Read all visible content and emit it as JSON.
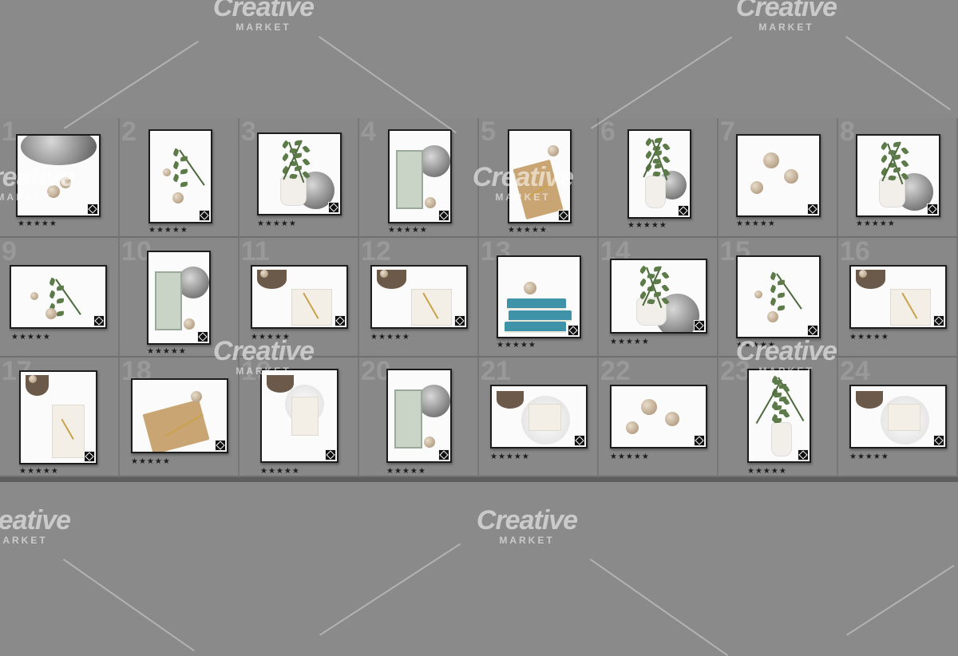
{
  "watermark": {
    "brand": "Creative",
    "tagline": "MARKET"
  },
  "rating_label": "★★★★★",
  "cells": [
    {
      "num": "1",
      "scene": "plate-balls"
    },
    {
      "num": "2",
      "scene": "branch-ball"
    },
    {
      "num": "3",
      "scene": "eucalyptus-plate"
    },
    {
      "num": "4",
      "scene": "lantern-plate"
    },
    {
      "num": "5",
      "scene": "notebook-pen"
    },
    {
      "num": "6",
      "scene": "vase-eucalyptus"
    },
    {
      "num": "7",
      "scene": "balls-shells"
    },
    {
      "num": "8",
      "scene": "eucalyptus-vase-crop"
    },
    {
      "num": "9",
      "scene": "branch-balls-flat"
    },
    {
      "num": "10",
      "scene": "vase-lantern"
    },
    {
      "num": "11",
      "scene": "basket-notebook"
    },
    {
      "num": "12",
      "scene": "basket-paper"
    },
    {
      "num": "13",
      "scene": "books-balls"
    },
    {
      "num": "14",
      "scene": "eucalyptus-plate-books"
    },
    {
      "num": "15",
      "scene": "branch-balls-pods"
    },
    {
      "num": "16",
      "scene": "basket-paper-pen"
    },
    {
      "num": "17",
      "scene": "basket-paper-vertical"
    },
    {
      "num": "18",
      "scene": "notebook-balls"
    },
    {
      "num": "19",
      "scene": "plate-paper-basket"
    },
    {
      "num": "20",
      "scene": "lantern-plate-2"
    },
    {
      "num": "21",
      "scene": "basket-plate"
    },
    {
      "num": "22",
      "scene": "balls-minimal"
    },
    {
      "num": "23",
      "scene": "fern-vase"
    },
    {
      "num": "24",
      "scene": "basket-plate-2"
    }
  ]
}
